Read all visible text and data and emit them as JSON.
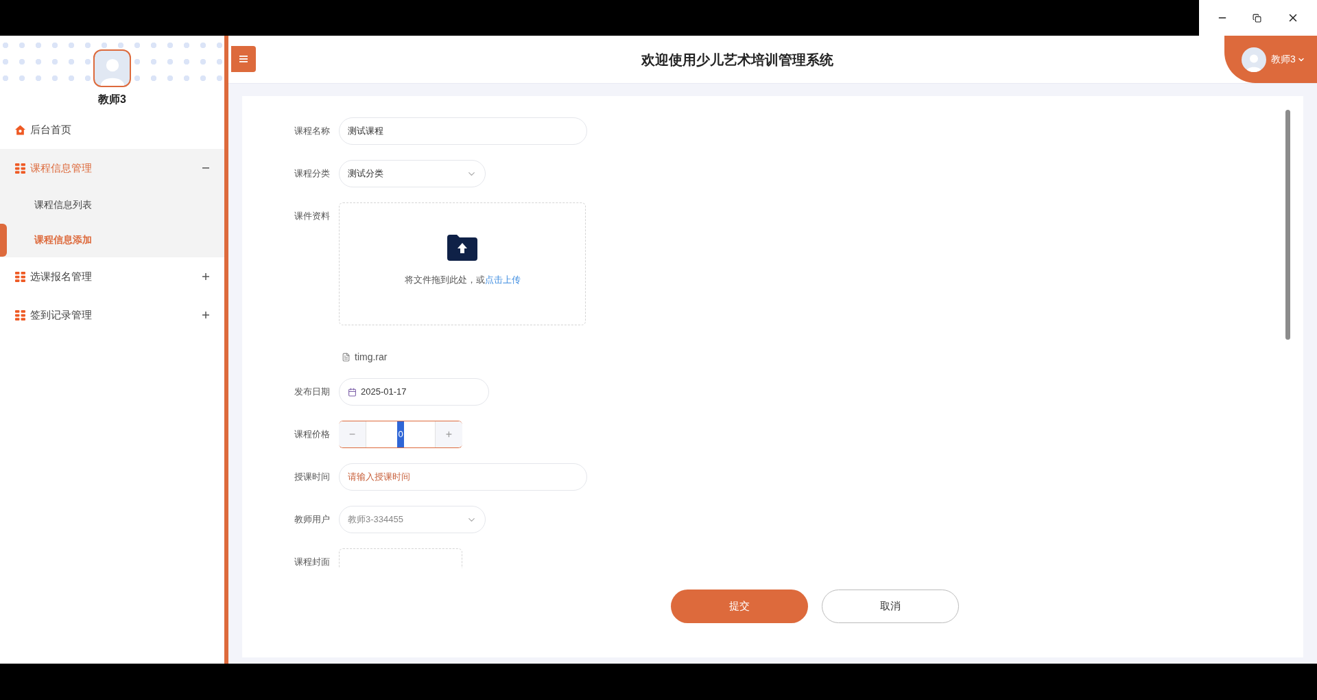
{
  "header": {
    "title": "欢迎使用少儿艺术培训管理系统",
    "user": "教师3"
  },
  "sidebar": {
    "user_name": "教师3",
    "items": [
      {
        "kind": "link",
        "label": "后台首页"
      },
      {
        "kind": "group",
        "label": "课程信息管理",
        "expanded": true,
        "children": [
          {
            "label": "课程信息列表",
            "selected": false
          },
          {
            "label": "课程信息添加",
            "selected": true
          }
        ]
      },
      {
        "kind": "group",
        "label": "选课报名管理",
        "expanded": false
      },
      {
        "kind": "group",
        "label": "签到记录管理",
        "expanded": false
      }
    ]
  },
  "form": {
    "fields": [
      {
        "kind": "text",
        "label": "课程名称",
        "value": "测试课程"
      },
      {
        "kind": "select",
        "label": "课程分类",
        "value": "测试分类",
        "disabled": false
      },
      {
        "kind": "upload",
        "label": "课件资料",
        "hint": "将文件拖到此处，或",
        "link": "点击上传",
        "files": [
          "timg.rar"
        ]
      },
      {
        "kind": "date",
        "label": "发布日期",
        "value": "2025-01-17"
      },
      {
        "kind": "number",
        "label": "课程价格",
        "value": "0",
        "minus": "−",
        "plus": "+"
      },
      {
        "kind": "text",
        "label": "授课时间",
        "placeholder": "请输入授课时间"
      },
      {
        "kind": "select",
        "label": "教师用户",
        "value": "教师3-334455",
        "disabled": true
      },
      {
        "kind": "image",
        "label": "课程封面"
      }
    ],
    "buttons": [
      {
        "kind": "primary",
        "label": "提交"
      },
      {
        "kind": "secondary",
        "label": "取消"
      }
    ]
  }
}
